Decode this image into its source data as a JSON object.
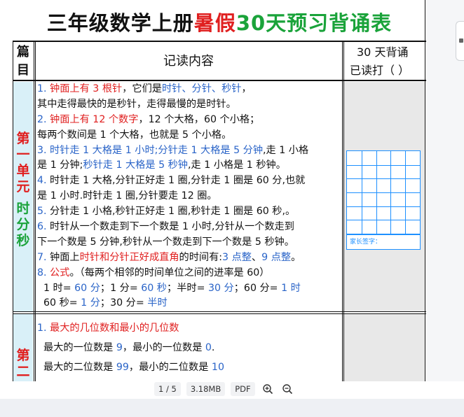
{
  "title": {
    "part1": "三年级数学上册",
    "part2": "暑假",
    "part3": "30天预习背诵表"
  },
  "header": {
    "col1_line1": "篇",
    "col1_line2": "目",
    "col2": "记读内容",
    "col3_line1": "30 天背诵",
    "col3_line2": "已读打（    ）"
  },
  "unit1": {
    "name_red": [
      "第",
      "一",
      "单",
      "元"
    ],
    "name_green": [
      "时",
      "分",
      "秒"
    ],
    "sign_label": "家长签字：",
    "items": [
      [
        {
          "t": "1. ",
          "c": "blue"
        },
        {
          "t": "钟面上有 3 根针",
          "c": "red"
        },
        {
          "t": "，它们是",
          "c": "black"
        },
        {
          "t": "时针、分针、秒针",
          "c": "blue"
        },
        {
          "t": "，",
          "c": "black"
        }
      ],
      [
        {
          "t": "其中走得最快的是秒针，走得最慢的是时针。",
          "c": "black"
        }
      ],
      [
        {
          "t": "2. ",
          "c": "blue"
        },
        {
          "t": "钟面上有 12 个数字",
          "c": "red"
        },
        {
          "t": "，12 个大格，60 个小格；",
          "c": "black"
        }
      ],
      [
        {
          "t": "每两个数间是 1 个大格，也就是 5 个小格。",
          "c": "black"
        }
      ],
      [
        {
          "t": "3. ",
          "c": "blue"
        },
        {
          "t": "时针走 1 大格是 1 小时;分针走 1 大格是 5 分钟",
          "c": "blue"
        },
        {
          "t": ",走 1 小格",
          "c": "black"
        }
      ],
      [
        {
          "t": "是 1 分钟;",
          "c": "black"
        },
        {
          "t": "秒针走 1 大格是 5 秒钟",
          "c": "blue"
        },
        {
          "t": ",走 1 小格是 1 秒钟。",
          "c": "black"
        }
      ],
      [
        {
          "t": "4. ",
          "c": "blue"
        },
        {
          "t": "时针走 1 大格,分针正好走 1 圈,分针走 1 圈是 60 分,也就",
          "c": "black"
        }
      ],
      [
        {
          "t": "是 1 小时.时针走 1 圈,分针要走 12 圈。",
          "c": "black"
        }
      ],
      [
        {
          "t": "5. ",
          "c": "blue"
        },
        {
          "t": "分针走 1 小格,秒针正好走 1 圈,秒针走 1 圈是 60 秒,。",
          "c": "black"
        }
      ],
      [
        {
          "t": "6. ",
          "c": "blue"
        },
        {
          "t": "时针从一个数走到下一个数是 1 小时,分针从一个数走到",
          "c": "black"
        }
      ],
      [
        {
          "t": "下一个数是 5 分钟,秒针从一个数走到下一个数是 5 秒钟。",
          "c": "black"
        }
      ],
      [
        {
          "t": "7. ",
          "c": "blue"
        },
        {
          "t": "钟面上",
          "c": "black"
        },
        {
          "t": "时针和分针正好成直角",
          "c": "red"
        },
        {
          "t": "的时间有:",
          "c": "black"
        },
        {
          "t": "3 点整",
          "c": "blue"
        },
        {
          "t": "、",
          "c": "black"
        },
        {
          "t": "9 点整",
          "c": "blue"
        },
        {
          "t": "。",
          "c": "black"
        }
      ],
      [
        {
          "t": "8. ",
          "c": "blue"
        },
        {
          "t": "公式",
          "c": "red"
        },
        {
          "t": "。（每两个相邻的时间单位之间的进率是 60）",
          "c": "black"
        }
      ],
      [
        {
          "t": "  1 时= ",
          "c": "black"
        },
        {
          "t": "60 分",
          "c": "blue"
        },
        {
          "t": "；1 分= ",
          "c": "black"
        },
        {
          "t": "60 秒",
          "c": "blue"
        },
        {
          "t": "；半时= ",
          "c": "black"
        },
        {
          "t": "30 分",
          "c": "blue"
        },
        {
          "t": "；60 分= ",
          "c": "black"
        },
        {
          "t": "1 时",
          "c": "blue"
        }
      ],
      [
        {
          "t": "  60 秒= ",
          "c": "black"
        },
        {
          "t": "1 分",
          "c": "blue"
        },
        {
          "t": "；30 分= ",
          "c": "black"
        },
        {
          "t": "半时",
          "c": "blue"
        }
      ]
    ]
  },
  "unit2": {
    "name_red": [
      "第",
      "二"
    ],
    "items": [
      [
        {
          "t": "1. ",
          "c": "blue"
        },
        {
          "t": "最大的几位数和最小的几位数",
          "c": "red"
        }
      ],
      [
        {
          "t": "  最大的一位数是 ",
          "c": "black"
        },
        {
          "t": "9",
          "c": "blue"
        },
        {
          "t": "，最小的一位数是 ",
          "c": "black"
        },
        {
          "t": "0",
          "c": "blue"
        },
        {
          "t": ".",
          "c": "black"
        }
      ],
      [
        {
          "t": "  最大的二位数是 ",
          "c": "black"
        },
        {
          "t": "99",
          "c": "blue"
        },
        {
          "t": "，最小的二位数是 ",
          "c": "black"
        },
        {
          "t": "10",
          "c": "blue"
        }
      ]
    ]
  },
  "toolbar": {
    "page": "1 / 5",
    "size": "3.18MB",
    "format": "PDF"
  }
}
